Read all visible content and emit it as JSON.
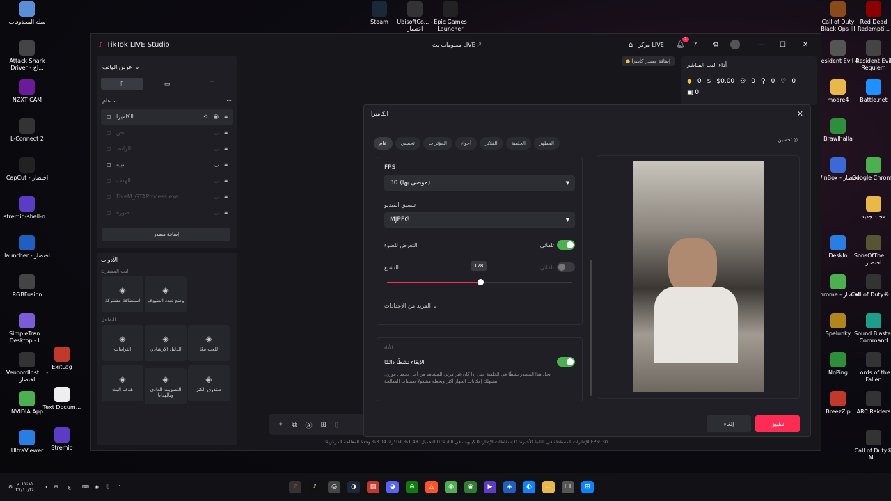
{
  "desktop_left": [
    {
      "label": "سلة المحذوفات",
      "icon": "recycle-bin-icon",
      "color": "#5a8fd8"
    },
    {
      "label": "Attack Shark Driver - اخ...",
      "icon": "shark-icon",
      "color": "#444"
    },
    {
      "label": "NZXT CAM",
      "icon": "nzxt-icon",
      "color": "#6a1b9a"
    },
    {
      "label": "L-Connect 2",
      "icon": "lconnect-icon",
      "color": "#333"
    },
    {
      "label": "CapCut - اختصار",
      "icon": "capcut-icon",
      "color": "#222"
    },
    {
      "label": "stremio-shell-n...",
      "icon": "stremio-icon",
      "color": "#5b3cc4"
    },
    {
      "label": "launcher - اختصار",
      "icon": "launcher-icon",
      "color": "#1e5fbf"
    },
    {
      "label": "RGBFusion",
      "icon": "rgbfusion-icon",
      "color": "#444"
    },
    {
      "label": "SimpleTran... Desktop - ا...",
      "icon": "simpletrans-icon",
      "color": "#7b5cd6"
    },
    {
      "label": "VencordInst... - اختصار",
      "icon": "vencord-icon",
      "color": "#333"
    },
    {
      "label": "NVIDIA App",
      "icon": "nvidia-icon",
      "color": "#4caf50"
    },
    {
      "label": "UltraViewer",
      "icon": "ultraviewer-icon",
      "color": "#2a7de1"
    }
  ],
  "desktop_col2": [
    {
      "label": "ExitLag",
      "icon": "exitlag-icon",
      "color": "#c0392b"
    },
    {
      "label": "Text Docum...",
      "icon": "text-document-icon",
      "color": "#eee"
    },
    {
      "label": "Stremio",
      "icon": "stremio-icon",
      "color": "#5b3cc4"
    }
  ],
  "desktop_top": [
    {
      "label": "Steam",
      "icon": "steam-icon",
      "color": "#1b2838"
    },
    {
      "label": "UbisoftCo... - اختصار",
      "icon": "ubisoft-icon",
      "color": "#333"
    },
    {
      "label": "Epic Games Launcher",
      "icon": "epic-icon",
      "color": "#222"
    }
  ],
  "desktop_right1": [
    {
      "label": "Call of Duty Black Ops III",
      "icon": "cod-icon",
      "color": "#8a4b1c"
    },
    {
      "label": "Resident Evil 4",
      "icon": "re4-icon",
      "color": "#555"
    },
    {
      "label": "modre4",
      "icon": "folder-icon",
      "color": "#e8b84a"
    },
    {
      "label": "Brawlhalla",
      "icon": "brawlhalla-icon",
      "color": "#2d8f3c"
    },
    {
      "label": "WinBox - اختصار",
      "icon": "winbox-icon",
      "color": "#3b6ad6"
    },
    {
      "label": "",
      "icon": "blank",
      "color": "transparent"
    },
    {
      "label": "DeskIn",
      "icon": "deskin-icon",
      "color": "#2a7de1"
    },
    {
      "label": "chrome - اختصار",
      "icon": "chrome-icon",
      "color": "#4caf50"
    },
    {
      "label": "Spelunky",
      "icon": "spelunky-icon",
      "color": "#b3861d"
    },
    {
      "label": "NoPing",
      "icon": "noping-icon",
      "color": "#2d8f3c"
    },
    {
      "label": "BreezZip",
      "icon": "breezzip-icon",
      "color": "#c0392b"
    }
  ],
  "desktop_right2": [
    {
      "label": "Red Dead Redempti...",
      "icon": "rdr-icon",
      "color": "#8b0000"
    },
    {
      "label": "Resident Evil Requiem",
      "icon": "re-requiem-icon",
      "color": "#444"
    },
    {
      "label": "Battle.net",
      "icon": "battlenet-icon",
      "color": "#1e90ff"
    },
    {
      "label": "",
      "icon": "blank",
      "color": "transparent"
    },
    {
      "label": "Google Chrome",
      "icon": "chrome-icon",
      "color": "#4caf50"
    },
    {
      "label": "مجلد جديد",
      "icon": "folder-icon",
      "color": "#e8b84a"
    },
    {
      "label": "SonsOfThe... - اختصار",
      "icon": "sonsoftheforest-icon",
      "color": "#553"
    },
    {
      "label": "Call of Duty® ...",
      "icon": "cod-icon",
      "color": "#333"
    },
    {
      "label": "Sound Blaster Command",
      "icon": "soundblaster-icon",
      "color": "#1e9e8a"
    },
    {
      "label": "Lords of the Fallen",
      "icon": "lotf-icon",
      "color": "#333"
    },
    {
      "label": "ARC Raiders",
      "icon": "arc-icon",
      "color": "#333"
    },
    {
      "label": "Call of Duty® M...",
      "icon": "cod-icon",
      "color": "#333"
    }
  ],
  "app": {
    "title": "TikTok LIVE Studio",
    "center_title": "معلومات بث LIVE",
    "live_center": "مركز LIVE",
    "notif_count": "2",
    "scene_title": "عرض الهاتف",
    "scene_group": "عام",
    "sources": [
      {
        "label": "الكاميرا",
        "dim": false
      },
      {
        "label": "نص",
        "dim": true
      },
      {
        "label": "الرابط",
        "dim": true
      },
      {
        "label": "تنبيه",
        "dim": false
      },
      {
        "label": "الهدف",
        "dim": true
      },
      {
        "label": "FiveM_GTAProcess.exe",
        "dim": true
      },
      {
        "label": "صورة",
        "dim": true
      }
    ],
    "add_source": "إضافة مصدر",
    "tools_title": "الأدوات",
    "shared_live": "البث المشترك",
    "tools_row1": [
      {
        "label": "استضافة مشتركة",
        "icon": "link-icon"
      },
      {
        "label": "وضع تعدد الضيوف",
        "icon": "multi-guest-icon"
      }
    ],
    "interaction": "التفاعل",
    "tools_row2": [
      {
        "label": "الترامات",
        "icon": "user-icon"
      },
      {
        "label": "الدليل الإرشادي",
        "icon": "guide-icon"
      },
      {
        "label": "للعب معًا",
        "icon": "play-icon"
      }
    ],
    "tools_row3": [
      {
        "label": "هدف البث",
        "icon": "target-icon"
      },
      {
        "label": "التصويت العادي وبالهدايا",
        "icon": "vote-icon"
      },
      {
        "label": "صندوق الكنز",
        "icon": "treasure-icon"
      }
    ],
    "add_camera_hint": "إضافة مصدر كاميرا",
    "stats_title": "أداء البث المباشر",
    "stats": [
      "0",
      "$0.00",
      "0",
      "0",
      "0",
      "0"
    ],
    "status_bar": "FPS: 30   الإطارات المسقطة في الثانية الأخيرة: 0   إسقاطات الإطار: 0   كيلوبت في الثانية: 0   التحميل: 1.48%   الذاكرة: 3.04%   وحدة المعالجة المركزية:"
  },
  "modal": {
    "title": "الكاميرا",
    "tabs": [
      "عام",
      "تحسين",
      "المؤثرات",
      "أجواء",
      "الفلاتر",
      "الخلفية",
      "المظهر"
    ],
    "enhance": "تحسين",
    "fps_label": "FPS",
    "fps_value": "30 (موصى بها)",
    "format_label": "تنسيق الفيديو",
    "format_value": "MJPEG",
    "exposure_label": "التعرض للضوء",
    "auto_label": "تلقائي",
    "saturation_label": "التشبع",
    "auto_label_off": "تلقائي",
    "slider_value": "128",
    "more_settings": "المزيد من الإعدادات",
    "perf_section": "الأداء",
    "keep_active_label": "الإبقاء نشطًا دائمًا",
    "keep_active_desc": "يحل هذا المصدر نشطًا في الخلفية حتى إذا كان غير مرئي للمشاهد من أجل تحميل فوري. يستهلك إمكانات الجهاز أكثر ويجعله مشغولاً بعمليات المعالجة.",
    "cancel": "إلغاء",
    "apply": "تطبيق"
  },
  "tray": {
    "time": "١١:٤١ م",
    "date": "٢٧/١٠/٢٤"
  }
}
